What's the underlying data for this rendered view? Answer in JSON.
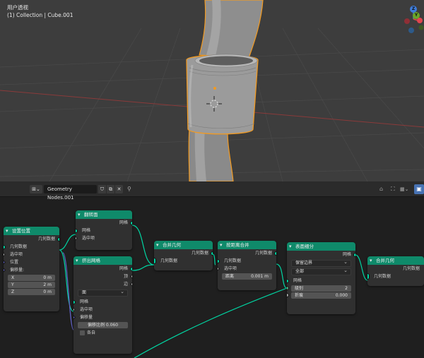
{
  "viewport": {
    "view_name": "用户透视",
    "object_info": "(1) Collection | Cube.001",
    "gizmo": {
      "z": "Z",
      "y": "Y",
      "x_color": "#e0464f",
      "y_color": "#6ba628",
      "z_color": "#3f7cd9"
    }
  },
  "editor_header": {
    "node_group_name": "Geometry Nodes.001",
    "editor_icon": "node-editor-icon",
    "pin_icon": "pin-icon"
  },
  "nodes": {
    "set_position": {
      "title": "设置位置",
      "out_geometry": "几何数据",
      "in_selection": "选中项",
      "in_position": "位置",
      "offset_label": "偏移量:",
      "offset": [
        {
          "axis": "X",
          "value": "0 m"
        },
        {
          "axis": "Y",
          "value": "2 m"
        },
        {
          "axis": "Z",
          "value": "0 m"
        }
      ]
    },
    "flip_faces": {
      "title": "翻转面",
      "out_mesh": "网格",
      "in_mesh": "网格",
      "in_selection": "选中项"
    },
    "extrude_mesh": {
      "title": "挤出网格",
      "out_mesh": "网格",
      "out_top": "顶",
      "out_side": "边",
      "mode": "面",
      "in_mesh": "网格",
      "in_selection": "选中项",
      "in_offset": "偏移量",
      "offset_scale_label": "偏移比例",
      "offset_scale": "0.060",
      "individual_label": "各自"
    },
    "join_geometry_1": {
      "title": "合并几何",
      "out_geometry": "几何数据",
      "in_geometry": "几何数据"
    },
    "merge_by_distance": {
      "title": "按距离合并",
      "out_geometry": "几何数据",
      "in_geometry": "几何数据",
      "in_selection": "选中项",
      "distance_label": "距离",
      "distance": "0.001 m"
    },
    "subdivide": {
      "title": "表面细分",
      "out_mesh": "网格",
      "boundary": "保留边界",
      "uv": "全部",
      "in_mesh": "网格",
      "level_label": "级别",
      "level": "2",
      "crease_label": "折痕",
      "crease": "0.000"
    },
    "join_geometry_2": {
      "title": "合并几何",
      "out_geometry": "几何数据",
      "in_geometry": "几何数据"
    }
  },
  "colors": {
    "node_header": "#0f8a6a",
    "geometry_socket": "#00d6a3",
    "vector_socket": "#6363c7",
    "selected_outline": "#f29a21"
  }
}
